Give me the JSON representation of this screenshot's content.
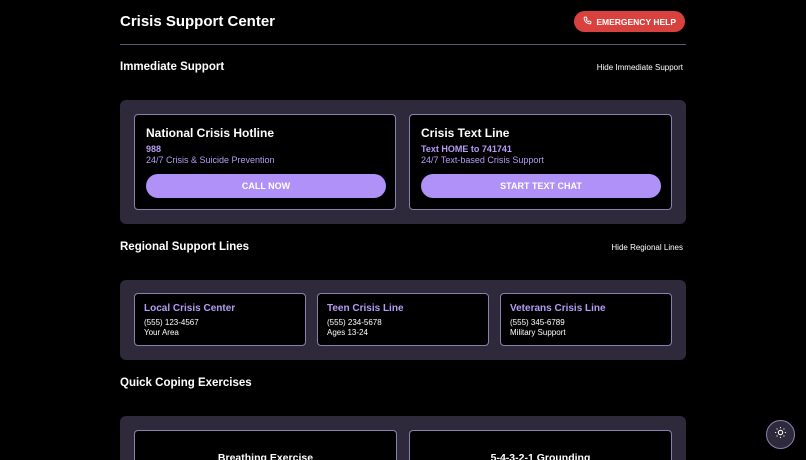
{
  "header": {
    "title": "Crisis Support Center",
    "emergency_label": "EMERGENCY HELP"
  },
  "immediate": {
    "title": "Immediate Support",
    "toggle_label": "Hide Immediate Support",
    "cards": [
      {
        "title": "National Crisis Hotline",
        "number": "988",
        "desc": "24/7 Crisis & Suicide Prevention",
        "button": "CALL NOW"
      },
      {
        "title": "Crisis Text Line",
        "number": "Text HOME to 741741",
        "desc": "24/7 Text-based Crisis Support",
        "button": "START TEXT CHAT"
      }
    ]
  },
  "regional": {
    "title": "Regional Support Lines",
    "toggle_label": "Hide Regional Lines",
    "lines": [
      {
        "name": "Local Crisis Center",
        "phone": "(555) 123-4567",
        "note": "Your Area"
      },
      {
        "name": "Teen Crisis Line",
        "phone": "(555) 234-5678",
        "note": "Ages 13-24"
      },
      {
        "name": "Veterans Crisis Line",
        "phone": "(555) 345-6789",
        "note": "Military Support"
      }
    ]
  },
  "coping": {
    "title": "Quick Coping Exercises",
    "exercises": [
      {
        "title": "Breathing Exercise"
      },
      {
        "title": "5-4-3-2-1 Grounding"
      }
    ]
  },
  "icons": {
    "emergency": "phone-icon",
    "theme": "sun-icon"
  },
  "colors": {
    "accent": "#b091f7",
    "emergency": "#d9413f",
    "panel": "#2e2a3b"
  }
}
